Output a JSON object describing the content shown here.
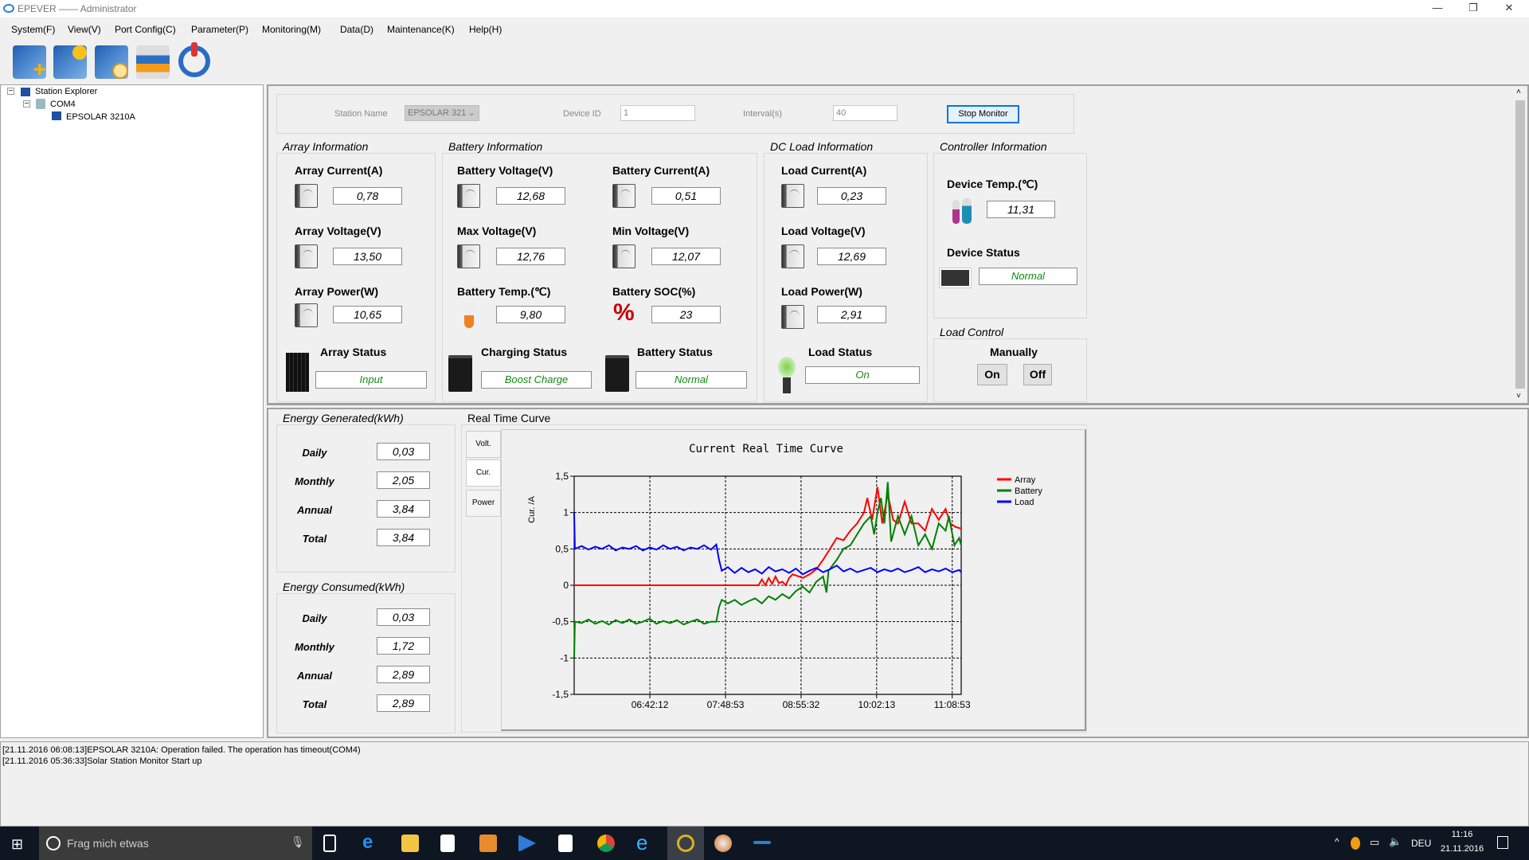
{
  "window": {
    "title": "EPEVER —— Administrator"
  },
  "menu": [
    "System(F)",
    "View(V)",
    "Port Config(C)",
    "Parameter(P)",
    "Monitoring(M)",
    "Data(D)",
    "Maintenance(K)",
    "Help(H)"
  ],
  "tree": {
    "root": "Station Explorer",
    "port": "COM4",
    "device": "EPSOLAR 3210A"
  },
  "station": {
    "station_name_label": "Station Name",
    "station_name_value": "EPSOLAR 321",
    "device_id_label": "Device ID",
    "device_id_value": "1",
    "interval_label": "Interval(s)",
    "interval_value": "40",
    "stop_label": "Stop Monitor"
  },
  "array": {
    "title": "Array Information",
    "current_label": "Array Current(A)",
    "current": "0,78",
    "voltage_label": "Array Voltage(V)",
    "voltage": "13,50",
    "power_label": "Array Power(W)",
    "power": "10,65",
    "status_label": "Array Status",
    "status": "Input"
  },
  "battery": {
    "title": "Battery Information",
    "voltage_label": "Battery Voltage(V)",
    "voltage": "12,68",
    "current_label": "Battery Current(A)",
    "current": "0,51",
    "max_label": "Max Voltage(V)",
    "max": "12,76",
    "min_label": "Min Voltage(V)",
    "min": "12,07",
    "temp_label": "Battery Temp.(℃)",
    "temp": "9,80",
    "soc_label": "Battery SOC(%)",
    "soc": "23",
    "charging_label": "Charging Status",
    "charging": "Boost Charge",
    "status_label": "Battery Status",
    "status": "Normal"
  },
  "load": {
    "title": "DC Load Information",
    "current_label": "Load Current(A)",
    "current": "0,23",
    "voltage_label": "Load Voltage(V)",
    "voltage": "12,69",
    "power_label": "Load Power(W)",
    "power": "2,91",
    "status_label": "Load Status",
    "status": "On"
  },
  "controller": {
    "title": "Controller Information",
    "temp_label": "Device Temp.(℃)",
    "temp": "11,31",
    "status_label": "Device Status",
    "status": "Normal"
  },
  "load_control": {
    "title": "Load Control",
    "mode": "Manually",
    "on": "On",
    "off": "Off"
  },
  "energy_generated": {
    "title": "Energy Generated(kWh)",
    "rows": [
      {
        "label": "Daily",
        "value": "0,03"
      },
      {
        "label": "Monthly",
        "value": "2,05"
      },
      {
        "label": "Annual",
        "value": "3,84"
      },
      {
        "label": "Total",
        "value": "3,84"
      }
    ]
  },
  "energy_consumed": {
    "title": "Energy Consumed(kWh)",
    "rows": [
      {
        "label": "Daily",
        "value": "0,03"
      },
      {
        "label": "Monthly",
        "value": "1,72"
      },
      {
        "label": "Annual",
        "value": "2,89"
      },
      {
        "label": "Total",
        "value": "2,89"
      }
    ]
  },
  "curve": {
    "title": "Real Time Curve",
    "tabs": [
      "Volt.",
      "Cur.",
      "Power"
    ]
  },
  "chart_data": {
    "type": "line",
    "title": "Current Real Time Curve",
    "xlabel": "",
    "ylabel": "Cur. /A",
    "ylim": [
      -1.5,
      1.5
    ],
    "xlim": [
      5.59,
      11.28
    ],
    "x_unit": "hour of day",
    "yticks": [
      {
        "v": 1.5,
        "l": "1,5"
      },
      {
        "v": 1,
        "l": "1"
      },
      {
        "v": 0.5,
        "l": "0,5"
      },
      {
        "v": 0,
        "l": "0"
      },
      {
        "v": -0.5,
        "l": "-0,5"
      },
      {
        "v": -1,
        "l": "-1"
      },
      {
        "v": -1.5,
        "l": "-1,5"
      }
    ],
    "xticks": [
      {
        "v": 6.703,
        "l": "06:42:12"
      },
      {
        "v": 7.815,
        "l": "07:48:53"
      },
      {
        "v": 8.926,
        "l": "08:55:32"
      },
      {
        "v": 10.037,
        "l": "10:02:13"
      },
      {
        "v": 11.148,
        "l": "11:08:53"
      }
    ],
    "grid": true,
    "legend": "top-right",
    "series": [
      {
        "name": "Array",
        "color": "#ff0000",
        "points": [
          [
            5.59,
            0
          ],
          [
            8.3,
            0
          ],
          [
            8.35,
            0.08
          ],
          [
            8.4,
            0
          ],
          [
            8.45,
            0.1
          ],
          [
            8.5,
            0.02
          ],
          [
            8.55,
            0.12
          ],
          [
            8.6,
            0.03
          ],
          [
            8.65,
            0.05
          ],
          [
            8.7,
            0.0
          ],
          [
            8.75,
            0.1
          ],
          [
            8.8,
            0.15
          ],
          [
            8.9,
            0.12
          ],
          [
            8.95,
            0.1
          ],
          [
            9.05,
            0.15
          ],
          [
            9.15,
            0.22
          ],
          [
            9.25,
            0.35
          ],
          [
            9.35,
            0.5
          ],
          [
            9.45,
            0.65
          ],
          [
            9.55,
            0.62
          ],
          [
            9.65,
            0.75
          ],
          [
            9.75,
            0.85
          ],
          [
            9.85,
            1.0
          ],
          [
            9.9,
            1.2
          ],
          [
            9.97,
            0.9
          ],
          [
            10.05,
            1.35
          ],
          [
            10.12,
            0.85
          ],
          [
            10.2,
            1.25
          ],
          [
            10.28,
            0.9
          ],
          [
            10.35,
            0.85
          ],
          [
            10.45,
            1.15
          ],
          [
            10.55,
            0.85
          ],
          [
            10.65,
            0.85
          ],
          [
            10.75,
            0.75
          ],
          [
            10.85,
            1.05
          ],
          [
            10.95,
            0.9
          ],
          [
            11.05,
            1.05
          ],
          [
            11.12,
            0.85
          ],
          [
            11.2,
            0.8
          ],
          [
            11.28,
            0.78
          ]
        ]
      },
      {
        "name": "Battery",
        "color": "#008000",
        "points": [
          [
            5.59,
            -1.0
          ],
          [
            5.6,
            -0.5
          ],
          [
            5.7,
            -0.52
          ],
          [
            5.8,
            -0.47
          ],
          [
            5.9,
            -0.53
          ],
          [
            6.0,
            -0.49
          ],
          [
            6.1,
            -0.54
          ],
          [
            6.2,
            -0.48
          ],
          [
            6.3,
            -0.52
          ],
          [
            6.4,
            -0.47
          ],
          [
            6.5,
            -0.53
          ],
          [
            6.6,
            -0.5
          ],
          [
            6.7,
            -0.46
          ],
          [
            6.8,
            -0.53
          ],
          [
            6.9,
            -0.49
          ],
          [
            7.0,
            -0.52
          ],
          [
            7.1,
            -0.48
          ],
          [
            7.2,
            -0.54
          ],
          [
            7.3,
            -0.5
          ],
          [
            7.4,
            -0.47
          ],
          [
            7.5,
            -0.53
          ],
          [
            7.6,
            -0.5
          ],
          [
            7.68,
            -0.5
          ],
          [
            7.72,
            -0.3
          ],
          [
            7.76,
            -0.2
          ],
          [
            7.85,
            -0.25
          ],
          [
            7.95,
            -0.2
          ],
          [
            8.05,
            -0.27
          ],
          [
            8.15,
            -0.22
          ],
          [
            8.25,
            -0.18
          ],
          [
            8.35,
            -0.25
          ],
          [
            8.45,
            -0.15
          ],
          [
            8.55,
            -0.2
          ],
          [
            8.65,
            -0.12
          ],
          [
            8.75,
            -0.18
          ],
          [
            8.85,
            -0.08
          ],
          [
            8.95,
            -0.02
          ],
          [
            9.05,
            -0.1
          ],
          [
            9.15,
            0.05
          ],
          [
            9.25,
            0.12
          ],
          [
            9.3,
            -0.1
          ],
          [
            9.33,
            0.2
          ],
          [
            9.45,
            0.35
          ],
          [
            9.55,
            0.5
          ],
          [
            9.65,
            0.55
          ],
          [
            9.75,
            0.7
          ],
          [
            9.85,
            0.85
          ],
          [
            9.95,
            0.95
          ],
          [
            10.0,
            0.7
          ],
          [
            10.05,
            1.0
          ],
          [
            10.1,
            1.2
          ],
          [
            10.15,
            0.85
          ],
          [
            10.2,
            1.42
          ],
          [
            10.25,
            0.6
          ],
          [
            10.35,
            0.95
          ],
          [
            10.45,
            0.7
          ],
          [
            10.55,
            0.95
          ],
          [
            10.65,
            0.55
          ],
          [
            10.75,
            0.7
          ],
          [
            10.85,
            0.5
          ],
          [
            10.95,
            0.85
          ],
          [
            11.05,
            0.75
          ],
          [
            11.1,
            0.95
          ],
          [
            11.18,
            0.55
          ],
          [
            11.25,
            0.65
          ],
          [
            11.28,
            0.55
          ]
        ]
      },
      {
        "name": "Load",
        "color": "#0000ff",
        "points": [
          [
            5.59,
            1.0
          ],
          [
            5.6,
            0.5
          ],
          [
            5.7,
            0.54
          ],
          [
            5.8,
            0.49
          ],
          [
            5.9,
            0.53
          ],
          [
            6.0,
            0.5
          ],
          [
            6.1,
            0.55
          ],
          [
            6.2,
            0.48
          ],
          [
            6.3,
            0.52
          ],
          [
            6.4,
            0.5
          ],
          [
            6.5,
            0.54
          ],
          [
            6.6,
            0.48
          ],
          [
            6.7,
            0.52
          ],
          [
            6.8,
            0.49
          ],
          [
            6.9,
            0.55
          ],
          [
            7.0,
            0.5
          ],
          [
            7.1,
            0.53
          ],
          [
            7.2,
            0.48
          ],
          [
            7.3,
            0.52
          ],
          [
            7.4,
            0.5
          ],
          [
            7.5,
            0.55
          ],
          [
            7.6,
            0.49
          ],
          [
            7.68,
            0.56
          ],
          [
            7.72,
            0.35
          ],
          [
            7.76,
            0.2
          ],
          [
            7.85,
            0.25
          ],
          [
            7.95,
            0.17
          ],
          [
            8.05,
            0.24
          ],
          [
            8.15,
            0.18
          ],
          [
            8.25,
            0.22
          ],
          [
            8.35,
            0.16
          ],
          [
            8.45,
            0.25
          ],
          [
            8.55,
            0.19
          ],
          [
            8.65,
            0.22
          ],
          [
            8.75,
            0.17
          ],
          [
            8.85,
            0.23
          ],
          [
            8.95,
            0.15
          ],
          [
            9.05,
            0.2
          ],
          [
            9.15,
            0.24
          ],
          [
            9.25,
            0.18
          ],
          [
            9.35,
            0.22
          ],
          [
            9.45,
            0.27
          ],
          [
            9.55,
            0.19
          ],
          [
            9.65,
            0.23
          ],
          [
            9.75,
            0.18
          ],
          [
            9.85,
            0.21
          ],
          [
            9.95,
            0.24
          ],
          [
            10.05,
            0.18
          ],
          [
            10.15,
            0.22
          ],
          [
            10.25,
            0.19
          ],
          [
            10.35,
            0.23
          ],
          [
            10.45,
            0.18
          ],
          [
            10.55,
            0.21
          ],
          [
            10.65,
            0.25
          ],
          [
            10.75,
            0.18
          ],
          [
            10.85,
            0.22
          ],
          [
            10.95,
            0.19
          ],
          [
            11.05,
            0.23
          ],
          [
            11.15,
            0.18
          ],
          [
            11.25,
            0.21
          ],
          [
            11.28,
            0.18
          ]
        ]
      }
    ]
  },
  "log": [
    "[21.11.2016 06:08:13]EPSOLAR 3210A: Operation failed.  The operation has timeout(COM4)",
    "[21.11.2016 05:36:33]Solar Station Monitor Start up"
  ],
  "taskbar": {
    "search_placeholder": "Frag mich etwas",
    "language": "DEU",
    "time": "11:16",
    "date": "21.11.2016"
  }
}
